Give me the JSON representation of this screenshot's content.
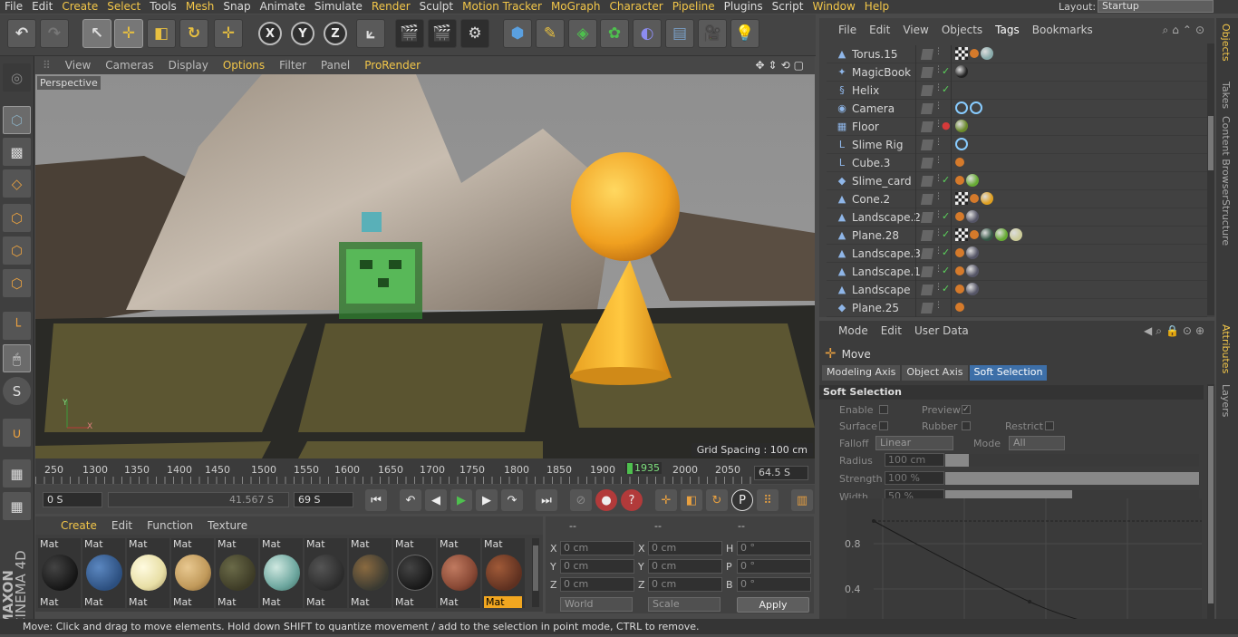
{
  "app": {
    "name": "CINEMA 4D",
    "vendor": "MAXON"
  },
  "menubar": [
    "File",
    "Edit",
    "Create",
    "Select",
    "Tools",
    "Mesh",
    "Snap",
    "Animate",
    "Simulate",
    "Render",
    "Sculpt",
    "Motion Tracker",
    "MoGraph",
    "Character",
    "Pipeline",
    "Plugins",
    "Script",
    "Window",
    "Help"
  ],
  "layout": {
    "label": "Layout:",
    "value": "Startup"
  },
  "viewport": {
    "menu": [
      "View",
      "Cameras",
      "Display",
      "Options",
      "Filter",
      "Panel",
      "ProRender"
    ],
    "label": "Perspective",
    "grid_spacing": "Grid Spacing : 100 cm",
    "axis_x": "X",
    "axis_y": "Y"
  },
  "timeline": {
    "ticks": [
      "250",
      "1300",
      "1350",
      "1400",
      "1450",
      "1500",
      "1550",
      "1600",
      "1650",
      "1700",
      "1750",
      "1800",
      "1850",
      "1900",
      "1950",
      "2000",
      "2050"
    ],
    "current_frame": "1935",
    "end_time": "64.5 S",
    "start_field": "0 S",
    "current_field": "41.567 S",
    "end_field": "69 S"
  },
  "material_manager": {
    "menu": [
      "Create",
      "Edit",
      "Function",
      "Texture"
    ],
    "materials": [
      {
        "top": "Mat",
        "bottom": "Mat",
        "color": "#151515"
      },
      {
        "top": "Mat",
        "bottom": "Mat",
        "color": "#2c4f7f"
      },
      {
        "top": "Mat",
        "bottom": "Mat",
        "color": "#e8dfa6"
      },
      {
        "top": "Mat",
        "bottom": "Mat",
        "color": "#c19a5b"
      },
      {
        "top": "Mat",
        "bottom": "Mat",
        "color": "#3d3b26"
      },
      {
        "top": "Mat",
        "bottom": "Mat",
        "color": "#6fa8a0"
      },
      {
        "top": "Mat",
        "bottom": "Mat",
        "color": "#2b2b2b"
      },
      {
        "top": "Mat",
        "bottom": "Mat",
        "color": "#3a3a32"
      },
      {
        "top": "Mat",
        "bottom": "Mat",
        "color": "#181818"
      },
      {
        "top": "Mat",
        "bottom": "Mat",
        "color": "#8a4a36"
      },
      {
        "top": "Mat",
        "bottom": "Mat",
        "color": "#5e3020",
        "selected": true
      }
    ]
  },
  "coordinates": {
    "headers": [
      "--",
      "--",
      "--"
    ],
    "rows": [
      {
        "l1": "X",
        "v1": "0 cm",
        "l2": "X",
        "v2": "0 cm",
        "l3": "H",
        "v3": "0 °"
      },
      {
        "l1": "Y",
        "v1": "0 cm",
        "l2": "Y",
        "v2": "0 cm",
        "l3": "P",
        "v3": "0 °"
      },
      {
        "l1": "Z",
        "v1": "0 cm",
        "l2": "Z",
        "v2": "0 cm",
        "l3": "B",
        "v3": "0 °"
      }
    ],
    "mode": "World",
    "type": "Scale",
    "apply": "Apply"
  },
  "object_manager": {
    "menu": [
      "File",
      "Edit",
      "View",
      "Objects",
      "Tags",
      "Bookmarks"
    ],
    "objects": [
      {
        "name": "Torus.15",
        "icon": "▲",
        "check": "",
        "check_color": "#888",
        "tags": [
          "chk",
          "dot",
          "ball:#8aa"
        ]
      },
      {
        "name": "MagicBook",
        "icon": "✦",
        "check": "✓",
        "check_color": "#5bd35b",
        "tags": [
          "ball:#222"
        ]
      },
      {
        "name": "Helix",
        "icon": "§",
        "check": "✓",
        "check_color": "#5bd35b",
        "tags": []
      },
      {
        "name": "Camera",
        "icon": "◉",
        "check": "",
        "check_color": "#888",
        "tags": [
          "ring:#8cf",
          "ring:#8cf"
        ]
      },
      {
        "name": "Floor",
        "icon": "▦",
        "check": "●",
        "check_color": "#d43a3a",
        "tags": [
          "ball:#6a8a2a"
        ]
      },
      {
        "name": "Slime Rig",
        "icon": "L",
        "check": "",
        "check_color": "#888",
        "tags": [
          "ring:#8cf"
        ]
      },
      {
        "name": "Cube.3",
        "icon": "L",
        "check": "",
        "check_color": "#888",
        "tags": [
          "dot"
        ]
      },
      {
        "name": "Slime_card",
        "icon": "◆",
        "check": "✓",
        "check_color": "#5bd35b",
        "tags": [
          "dot",
          "ball:#6a3"
        ]
      },
      {
        "name": "Cone.2",
        "icon": "▲",
        "check": "",
        "check_color": "#888",
        "tags": [
          "chk",
          "dot",
          "ball:#e0a020"
        ]
      },
      {
        "name": "Landscape.2",
        "icon": "▲",
        "check": "✓",
        "check_color": "#5bd35b",
        "tags": [
          "dot",
          "ball:#556"
        ]
      },
      {
        "name": "Plane.28",
        "icon": "▲",
        "check": "✓",
        "check_color": "#5bd35b",
        "tags": [
          "chk",
          "dot",
          "ball:#354",
          "ball:#6a3",
          "ball:#cc9"
        ]
      },
      {
        "name": "Landscape.3",
        "icon": "▲",
        "check": "✓",
        "check_color": "#5bd35b",
        "tags": [
          "dot",
          "ball:#556"
        ]
      },
      {
        "name": "Landscape.1",
        "icon": "▲",
        "check": "✓",
        "check_color": "#5bd35b",
        "tags": [
          "dot",
          "ball:#556"
        ]
      },
      {
        "name": "Landscape",
        "icon": "▲",
        "check": "✓",
        "check_color": "#5bd35b",
        "tags": [
          "dot",
          "ball:#556"
        ]
      },
      {
        "name": "Plane.25",
        "icon": "◆",
        "check": "",
        "check_color": "#888",
        "tags": [
          "dot"
        ]
      }
    ]
  },
  "attributes": {
    "menu": [
      "Mode",
      "Edit",
      "User Data"
    ],
    "tool": "Move",
    "tabs": [
      "Modeling Axis",
      "Object Axis",
      "Soft Selection"
    ],
    "active_tab": "Soft Selection",
    "section": "Soft Selection",
    "enable": "Enable",
    "preview": "Preview",
    "surface": "Surface",
    "rubber": "Rubber",
    "restrict": "Restrict",
    "falloff": "Falloff",
    "falloff_value": "Linear",
    "mode": "Mode",
    "mode_value": "All",
    "radius": "Radius",
    "radius_value": "100 cm",
    "strength": "Strength",
    "strength_value": "100 %",
    "width": "Width . .",
    "width_value": "50 %",
    "width_fraction": 0.5,
    "curve_labels": [
      "0.8",
      "0.4"
    ]
  },
  "side_tabs": [
    "Objects",
    "Takes",
    "Content Browser",
    "Structure",
    "Attributes",
    "Layers"
  ],
  "status": "Move: Click and drag to move elements. Hold down SHIFT to quantize movement / add to the selection in point mode, CTRL to remove."
}
